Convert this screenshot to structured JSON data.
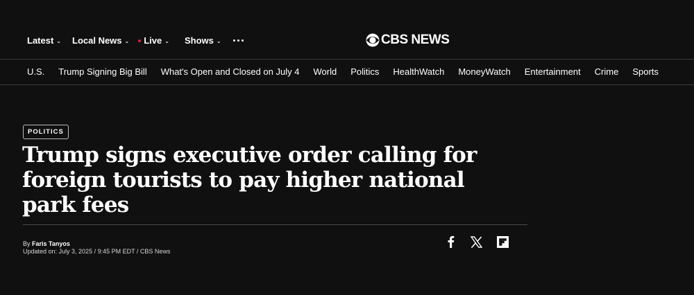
{
  "header": {
    "nav": {
      "latest": "Latest",
      "local_news": "Local News",
      "live": "Live",
      "shows": "Shows"
    },
    "brand": "CBS NEWS",
    "live_dot_color": "#e4203c",
    "icons": [
      "chevron-down-icon",
      "more-dots-icon",
      "cbs-eye-logo"
    ]
  },
  "sections": [
    "U.S.",
    "Trump Signing Big Bill",
    "What's Open and Closed on July 4",
    "World",
    "Politics",
    "HealthWatch",
    "MoneyWatch",
    "Entertainment",
    "Crime",
    "Sports"
  ],
  "article": {
    "tag": "POLITICS",
    "headline": "Trump signs executive order calling for foreign tourists to pay higher national park fees",
    "byline_prefix": "By ",
    "author": "Faris Tanyos",
    "updated": "Updated on: July 3, 2025 / 9:45 PM EDT / CBS News"
  },
  "share": {
    "icons": [
      "facebook-icon",
      "x-icon",
      "flipboard-icon"
    ]
  },
  "colors": {
    "background": "#101010",
    "text": "#ffffff",
    "divider": "#3a3a3a"
  }
}
